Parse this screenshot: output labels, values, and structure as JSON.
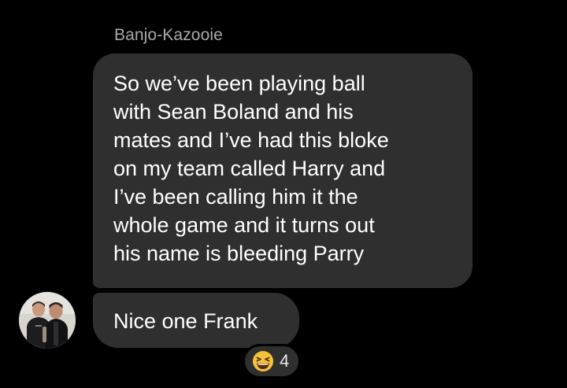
{
  "thread": {
    "sender_name": "Banjo-Kazooie",
    "messages": [
      {
        "lines": [
          "So we’ve been playing ball",
          "with Sean Boland and his",
          "mates and I’ve had this bloke",
          "on my team called Harry and",
          "I’ve been calling him it the",
          "whole game and it turns out",
          "his name is bleeding Parry"
        ]
      },
      {
        "text": "Nice one Frank",
        "reaction": {
          "emoji": "grinning-squinting-face",
          "count": "4"
        }
      }
    ]
  },
  "colors": {
    "background": "#000000",
    "bubble": "#2f2f2f",
    "sender_text": "#a9a9a9",
    "message_text": "#ffffff"
  }
}
